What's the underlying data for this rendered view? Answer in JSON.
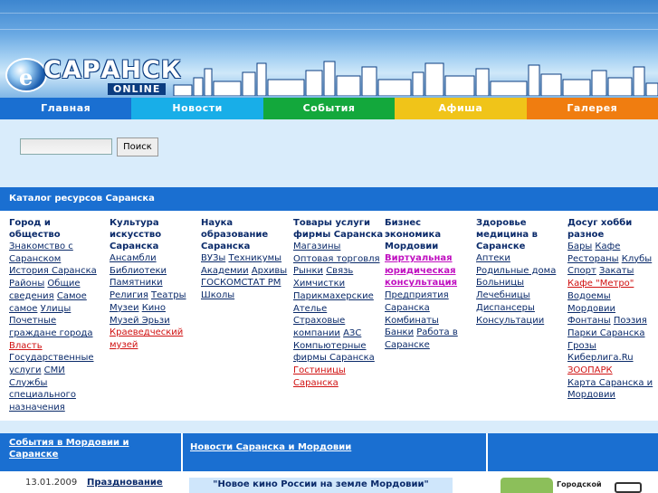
{
  "logo": {
    "main": "САРАНСК",
    "sub": "ONLINE"
  },
  "nav": [
    {
      "label": "Главная",
      "color": "#1a6fd1"
    },
    {
      "label": "Новости",
      "color": "#18aee8"
    },
    {
      "label": "События",
      "color": "#13a83c"
    },
    {
      "label": "Афиша",
      "color": "#f0c419"
    },
    {
      "label": "Галерея",
      "color": "#f07d10"
    }
  ],
  "search": {
    "button": "Поиск",
    "value": ""
  },
  "catalog": {
    "title": "Каталог ресурсов Саранска",
    "columns": [
      {
        "title": "Город и общество",
        "links": [
          "Знакомство с Саранском",
          "История Саранска",
          "Районы",
          "Общие сведения",
          "Самое самое",
          "Улицы",
          "Почетные граждане города",
          "Власть",
          "Государственные услуги",
          "СМИ",
          "Службы специального назначения"
        ]
      },
      {
        "title": "Культура искусство Саранска",
        "links": [
          "Ансамбли",
          "Библиотеки",
          "Памятники",
          "Религия",
          "Театры",
          "Музеи",
          "Кино",
          "Музей Эрьзи",
          "Краеведческий музей"
        ]
      },
      {
        "title": "Наука образование Саранска",
        "links": [
          "ВУЗы",
          "Техникумы",
          "Академии",
          "Архивы",
          "ГОСКОМСТАТ РМ",
          "Школы"
        ]
      },
      {
        "title": "Товары услуги фирмы Саранска",
        "links": [
          "Магазины",
          "Оптовая торговля",
          "Рынки",
          "Связь",
          "Химчистки",
          "Парикмахерские",
          "Ателье",
          "Страховые компании",
          "АЗС",
          "Компьютерные фирмы Саранска",
          "Гостиницы Саранска"
        ]
      },
      {
        "title": "Бизнес экономика Мордовии",
        "links": [
          "Виртуальная юридическая консультация",
          "Предприятия Саранска",
          "Комбинаты",
          "Банки",
          "Работа в Саранске"
        ]
      },
      {
        "title": "Здоровье медицина в Саранске",
        "links": [
          "Аптеки",
          "Родильные дома",
          "Больницы",
          "Лечебницы",
          "Диспансеры",
          "Консультации"
        ]
      },
      {
        "title": "Досуг хобби разное",
        "links": [
          "Бары",
          "Кафе",
          "Рестораны",
          "Клубы",
          "Спорт",
          "Закаты",
          "Кафе \"Метро\"",
          "Водоемы",
          "Мордовии",
          "Фонтаны",
          "Поэзия",
          "Парки Саранска",
          "Грозы",
          "Киберлига.Ru",
          "ЗООПАРК",
          "Карта Саранска и Мордовии"
        ]
      }
    ]
  },
  "bottom": {
    "events_title": "События в Мордовии и Саранске",
    "news_title": "Новости Саранска и Мордовии",
    "date": "13.01.2009",
    "event_link": "Празднование",
    "film_box": "\"Новое кино России на земле Мордовии\"",
    "city_label": "Городской"
  }
}
